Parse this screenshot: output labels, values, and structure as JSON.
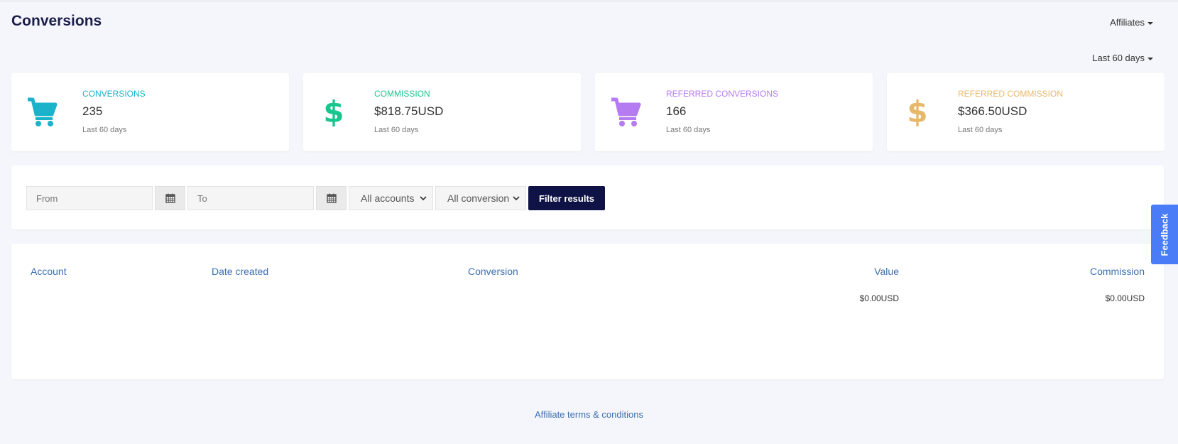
{
  "header": {
    "title": "Conversions",
    "affiliates_label": "Affiliates",
    "period_label": "Last 60 days"
  },
  "stats": [
    {
      "label": "CONVERSIONS",
      "value": "235",
      "sub": "Last 60 days",
      "icon": "cart-icon",
      "color": "#1ab3c9"
    },
    {
      "label": "COMMISSION",
      "value": "$818.75USD",
      "sub": "Last 60 days",
      "icon": "dollar-icon",
      "color": "#19c68e"
    },
    {
      "label": "REFERRED CONVERSIONS",
      "value": "166",
      "sub": "Last 60 days",
      "icon": "cart-icon",
      "color": "#b57bf0"
    },
    {
      "label": "REFERRED COMMISSION",
      "value": "$366.50USD",
      "sub": "Last 60 days",
      "icon": "dollar-icon",
      "color": "#e8b86a"
    }
  ],
  "filters": {
    "from_placeholder": "From",
    "to_placeholder": "To",
    "accounts_value": "All accounts",
    "conversion_value": "All conversion",
    "filter_button": "Filter results"
  },
  "table": {
    "headers": [
      "Account",
      "Date created",
      "Conversion",
      "Value",
      "Commission"
    ],
    "rows": [
      {
        "account": "",
        "date_created": "",
        "conversion": "",
        "value": "$0.00USD",
        "commission": "$0.00USD"
      }
    ]
  },
  "footer": {
    "terms_link": "Affiliate terms & conditions"
  },
  "feedback": {
    "label": "Feedback"
  }
}
